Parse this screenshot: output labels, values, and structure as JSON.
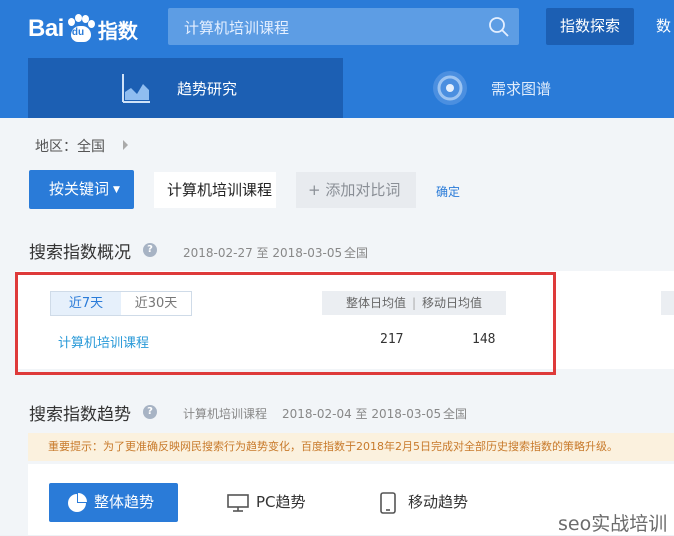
{
  "header": {
    "logo_text": "Bai",
    "logo_paw": "du",
    "logo_suffix": "指数",
    "search_value": "计算机培训课程",
    "explore_label": "指数探索",
    "nav_more_label": "数"
  },
  "subnav": {
    "tabs": [
      {
        "label": "趋势研究",
        "active": true,
        "icon": "trend-chart-icon"
      },
      {
        "label": "需求图谱",
        "active": false,
        "icon": "target-icon"
      }
    ]
  },
  "filters": {
    "region_label": "地区：全国",
    "keyword_button": "按关键词",
    "keyword_value": "计算机培训课程",
    "add_compare": "+ 添加对比词",
    "confirm": "确定"
  },
  "overview": {
    "title": "搜索指数概况",
    "date_range": "2018-02-27 至 2018-03-05",
    "region": "全国",
    "range_tabs": [
      "近7天",
      "近30天"
    ],
    "col_overall": "整体日均值",
    "col_sep": "|",
    "col_mobile": "移动日均值",
    "rows": [
      {
        "keyword": "计算机培训课程",
        "overall": "217",
        "mobile": "148"
      }
    ]
  },
  "trend": {
    "title": "搜索指数趋势",
    "keyword": "计算机培训课程",
    "date_range": "2018-02-04 至 2018-03-05",
    "region": "全国",
    "notice": "重要提示：为了更准确反映网民搜索行为趋势变化，百度指数于2018年2月5日完成对全部历史搜索指数的策略升级。",
    "tabs": {
      "overall": "整体趋势",
      "pc": "PC趋势",
      "mobile": "移动趋势"
    }
  },
  "watermark": "seo实战培训",
  "colors": {
    "primary": "#2a7bd8",
    "dark_primary": "#1c5fb3",
    "highlight": "#de3a3a",
    "notice_bg": "#fbf1de"
  }
}
